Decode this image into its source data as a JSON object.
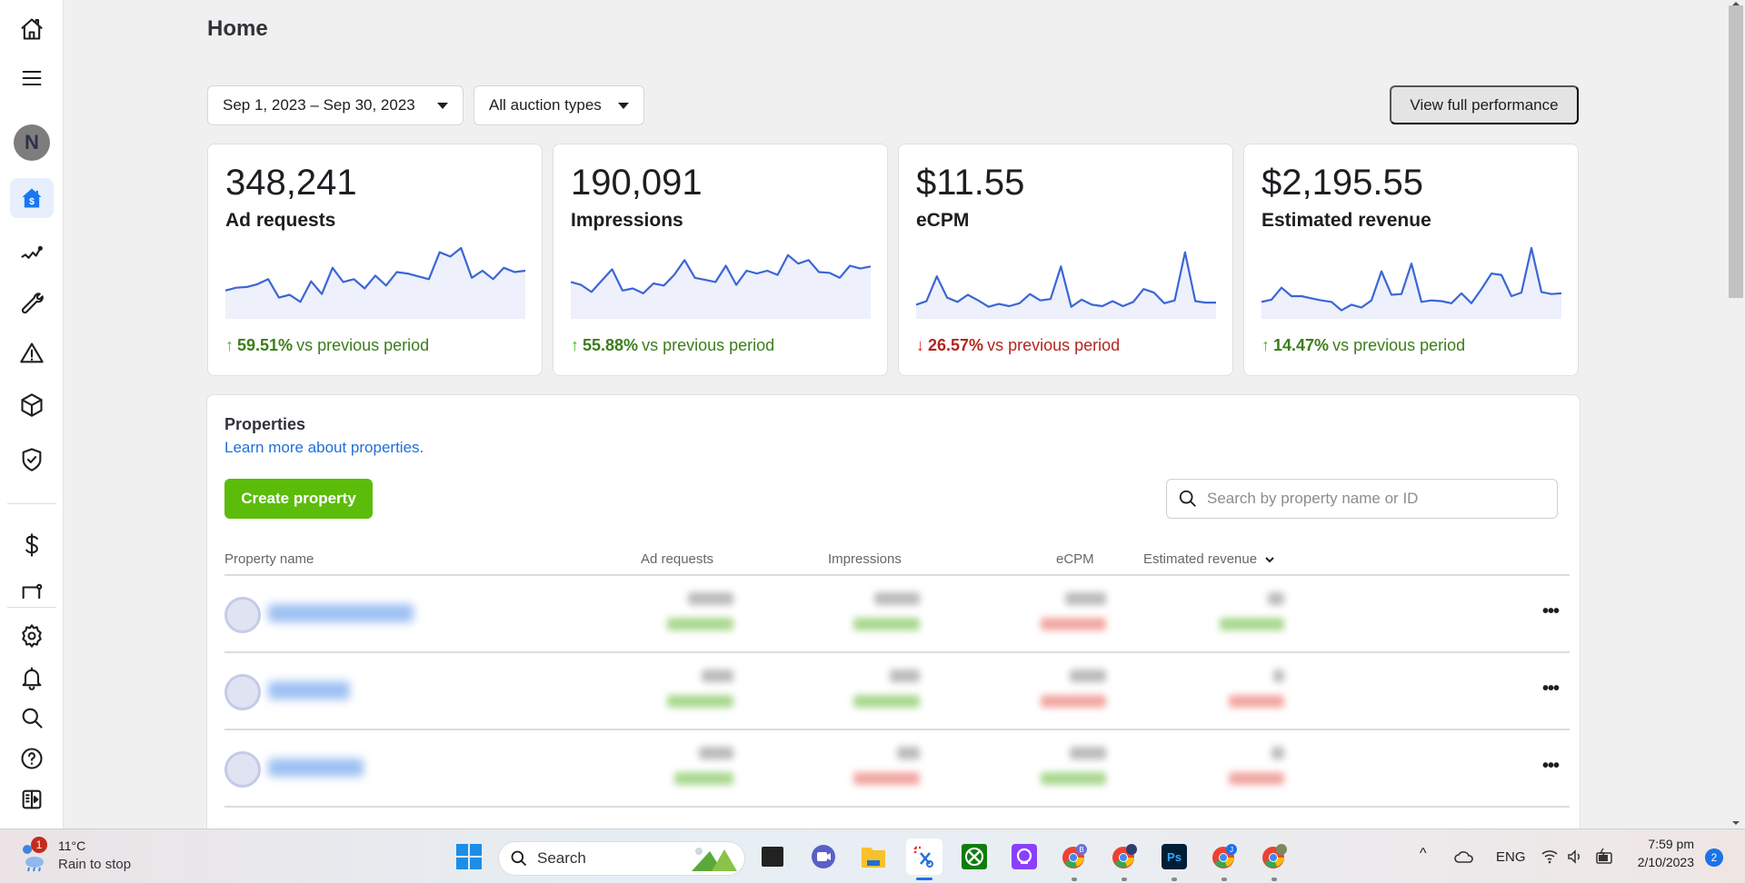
{
  "sidebar": {
    "items": [
      {
        "name": "home",
        "label": "Home"
      },
      {
        "name": "menu",
        "label": "Menu"
      },
      {
        "name": "account",
        "avatar_initial": "N"
      },
      {
        "name": "monetization-home",
        "label": "Monetization home",
        "active": true
      },
      {
        "name": "performance",
        "label": "Performance"
      },
      {
        "name": "integration",
        "label": "Integration"
      },
      {
        "name": "alerts",
        "label": "Alerts"
      },
      {
        "name": "products",
        "label": "Products"
      },
      {
        "name": "brand-safety",
        "label": "Brand safety"
      },
      {
        "name": "payouts",
        "label": "Payouts"
      },
      {
        "name": "business-settings",
        "label": "Business"
      },
      {
        "name": "settings",
        "label": "Settings"
      },
      {
        "name": "notifications",
        "label": "Notifications"
      },
      {
        "name": "search",
        "label": "Search"
      },
      {
        "name": "help",
        "label": "Help"
      },
      {
        "name": "collapse",
        "label": "Collapse"
      }
    ]
  },
  "header": {
    "title": "Home"
  },
  "filters": {
    "date_range": "Sep 1, 2023 – Sep 30, 2023",
    "auction_type": "All auction types",
    "view_full_label": "View full performance"
  },
  "kpis": [
    {
      "value": "348,241",
      "label": "Ad requests",
      "change": "59.51%",
      "direction": "up",
      "suffix": "vs previous period",
      "trend": [
        40,
        44,
        45,
        49,
        56,
        30,
        34,
        24,
        53,
        35,
        72,
        52,
        56,
        43,
        61,
        47,
        66,
        64,
        60,
        56,
        94,
        88,
        100,
        58,
        68,
        56,
        72,
        66,
        68
      ]
    },
    {
      "value": "190,091",
      "label": "Impressions",
      "change": "55.88%",
      "direction": "up",
      "suffix": "vs previous period",
      "trend": [
        52,
        48,
        38,
        54,
        70,
        40,
        43,
        36,
        50,
        47,
        62,
        83,
        58,
        55,
        52,
        75,
        48,
        68,
        64,
        68,
        62,
        90,
        78,
        83,
        66,
        65,
        58,
        75,
        71,
        74
      ]
    },
    {
      "value": "$11.55",
      "label": "eCPM",
      "change": "26.57%",
      "direction": "down",
      "suffix": "vs previous period",
      "trend": [
        20,
        25,
        60,
        30,
        24,
        34,
        26,
        17,
        21,
        18,
        22,
        35,
        26,
        28,
        74,
        17,
        27,
        20,
        18,
        25,
        18,
        24,
        42,
        37,
        22,
        26,
        94,
        25,
        23,
        23
      ]
    },
    {
      "value": "$2,195.55",
      "label": "Estimated revenue",
      "change": "14.47%",
      "direction": "up",
      "suffix": "vs previous period",
      "trend": [
        24,
        27,
        44,
        32,
        32,
        29,
        26,
        24,
        12,
        20,
        16,
        26,
        67,
        34,
        35,
        78,
        24,
        26,
        25,
        22,
        36,
        22,
        42,
        64,
        62,
        32,
        37,
        100,
        38,
        35,
        36
      ]
    }
  ],
  "properties": {
    "title": "Properties",
    "learn_more": "Learn more about properties.",
    "create_label": "Create property",
    "search_placeholder": "Search by property name or ID",
    "columns": [
      "Property name",
      "Ad requests",
      "Impressions",
      "eCPM",
      "Estimated revenue"
    ],
    "sorted_column": "Estimated revenue",
    "rows": [
      {
        "name": "[redacted]",
        "ad_requests": "[redacted]",
        "ad_requests_dir": "up",
        "impressions": "[redacted]",
        "impressions_dir": "up",
        "ecpm": "[redacted]",
        "ecpm_dir": "down",
        "revenue": "[redacted]",
        "revenue_dir": "up"
      },
      {
        "name": "[redacted]",
        "ad_requests": "[redacted]",
        "ad_requests_dir": "up",
        "impressions": "[redacted]",
        "impressions_dir": "up",
        "ecpm": "[redacted]",
        "ecpm_dir": "down",
        "revenue": "[redacted]",
        "revenue_dir": "down"
      },
      {
        "name": "[redacted]",
        "ad_requests": "[redacted]",
        "ad_requests_dir": "up",
        "impressions": "[redacted]",
        "impressions_dir": "down",
        "ecpm": "[redacted]",
        "ecpm_dir": "up",
        "revenue": "[redacted]",
        "revenue_dir": "down"
      }
    ],
    "more_label": "•••"
  },
  "taskbar": {
    "weather_temp": "11°C",
    "weather_desc": "Rain to stop",
    "weather_badge": "1",
    "search_label": "Search",
    "apps": [
      "Start",
      "Search",
      "Task View",
      "Meet",
      "File Explorer",
      "Snipping Tool",
      "Xbox",
      "Proton",
      "Chrome B",
      "Chrome",
      "Photoshop",
      "Chrome J",
      "Chrome"
    ],
    "language": "ENG",
    "time": "7:59 pm",
    "date": "2/10/2023",
    "notification_count": "2"
  },
  "colors": {
    "accent": "#1877f2",
    "line": "#3b66d6",
    "fill": "#eef0fb",
    "up": "#3c7d1a",
    "down": "#b3261e",
    "create": "#5cbc0a"
  }
}
